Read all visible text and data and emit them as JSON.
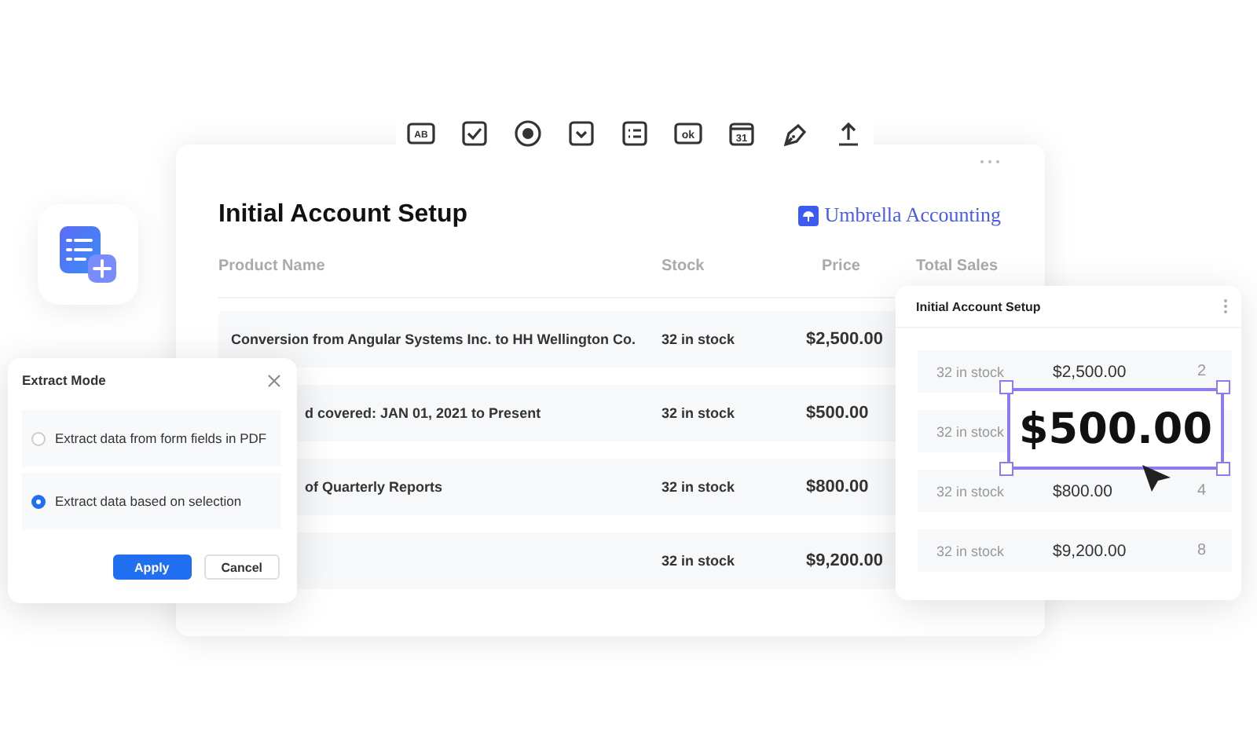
{
  "toolbar": [
    {
      "kind": "text-field",
      "text": "AB"
    },
    {
      "kind": "checkbox"
    },
    {
      "kind": "radio"
    },
    {
      "kind": "dropdown"
    },
    {
      "kind": "list"
    },
    {
      "kind": "button",
      "text": "ok"
    },
    {
      "kind": "date",
      "text": "31"
    },
    {
      "kind": "signature"
    },
    {
      "kind": "upload"
    }
  ],
  "table_card": {
    "title": "Initial Account Setup",
    "brand": "Umbrella Accounting",
    "columns": [
      "Product Name",
      "Stock",
      "Price",
      "Total Sales"
    ],
    "rows": [
      {
        "name": "Conversion from Angular Systems Inc. to HH Wellington Co.",
        "clipped": false,
        "stock": "32 in stock",
        "price": "$2,500.00"
      },
      {
        "name": "d covered: JAN 01, 2021 to Present",
        "clipped": true,
        "stock": "32 in stock",
        "price": "$500.00"
      },
      {
        "name": "of Quarterly Reports",
        "clipped": true,
        "stock": "32 in stock",
        "price": "$800.00"
      },
      {
        "stock": "32 in stock",
        "price": "$9,200.00"
      }
    ]
  },
  "dialog": {
    "title": "Extract Mode",
    "options": [
      {
        "label": "Extract data from form fields in PDF",
        "selected": false
      },
      {
        "label": "Extract data based on selection",
        "selected": true
      }
    ],
    "buttons": [
      {
        "label": "Apply",
        "kind": "primary"
      },
      {
        "label": "Cancel",
        "kind": "secondary"
      }
    ]
  },
  "side_panel": {
    "title": "Initial Account Setup",
    "rows": [
      {
        "stock": "32 in stock",
        "price": "$2,500.00",
        "count": "2"
      },
      {
        "stock": "32 in stock"
      },
      {
        "stock": "32 in stock",
        "price": "$800.00",
        "count": "4"
      },
      {
        "stock": "32 in stock",
        "price": "$9,200.00",
        "count": "8"
      }
    ],
    "selection": {
      "text": "$500.00"
    }
  }
}
